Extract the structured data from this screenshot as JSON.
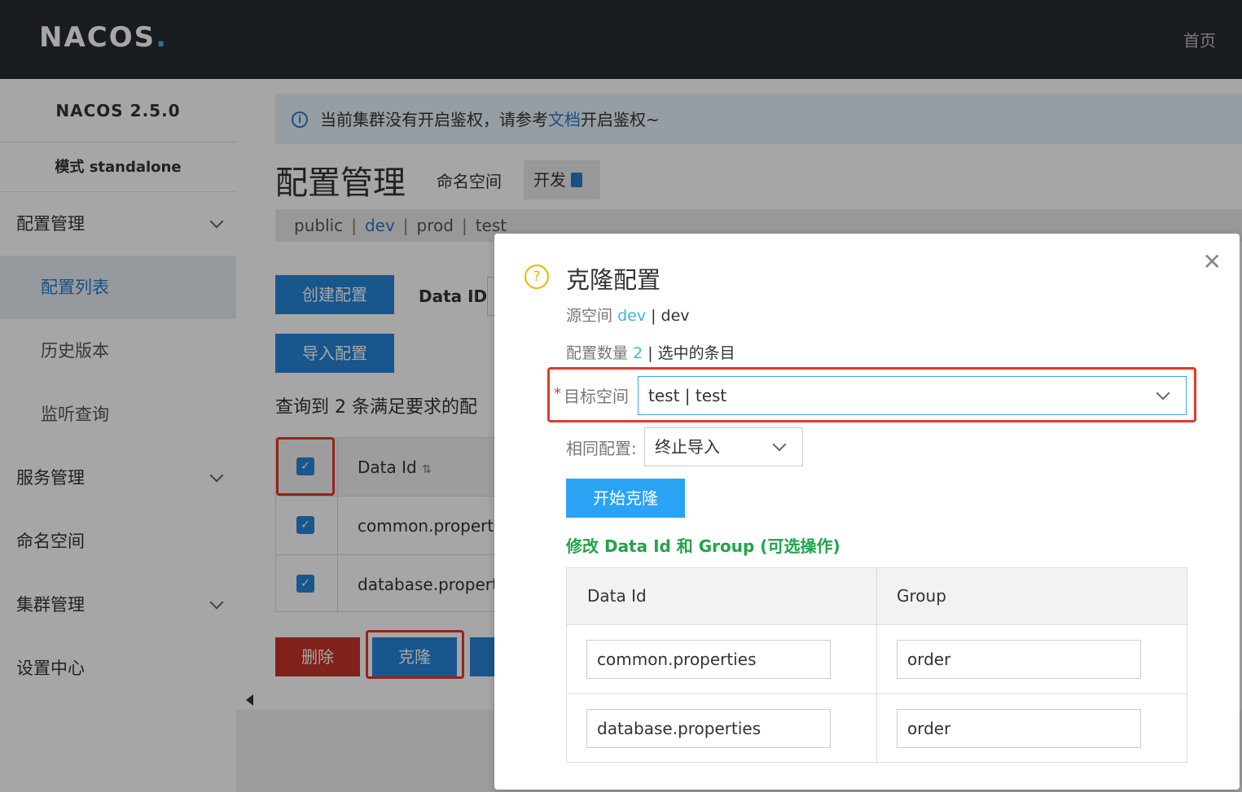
{
  "topbar": {
    "logo_main": "NACOS",
    "logo_dot": ".",
    "home": "首页"
  },
  "sidebar": {
    "version": "NACOS 2.5.0",
    "mode": "模式 standalone",
    "items": [
      {
        "label": "配置管理"
      },
      {
        "label": "配置列表"
      },
      {
        "label": "历史版本"
      },
      {
        "label": "监听查询"
      },
      {
        "label": "服务管理"
      },
      {
        "label": "命名空间"
      },
      {
        "label": "集群管理"
      },
      {
        "label": "设置中心"
      }
    ]
  },
  "main": {
    "notice_prefix": "当前集群没有开启鉴权，请参考",
    "notice_link": "文档",
    "notice_suffix": "开启鉴权~",
    "page_title": "配置管理",
    "namespace_label": "命名空间",
    "namespace_current": "开发",
    "namespaces": [
      "public",
      "dev",
      "prod",
      "test"
    ],
    "create_btn": "创建配置",
    "import_btn": "导入配置",
    "dataid_label": "Data ID",
    "result_text": "查询到 2 条满足要求的配",
    "table": {
      "header_dataid": "Data Id",
      "rows": [
        "common.propertie",
        "database.propertie"
      ]
    },
    "delete_btn": "删除",
    "clone_btn": "克隆"
  },
  "dialog": {
    "title": "克隆配置",
    "source_label": "源空间",
    "source_ns": "dev",
    "source_sep": " | dev",
    "count_label": "配置数量",
    "count_value": "2",
    "count_suffix": " | 选中的条目",
    "target_label": "目标空间",
    "target_value": "test | test",
    "same_label": "相同配置:",
    "same_value": "终止导入",
    "start_btn": "开始克隆",
    "modify_title": "修改 Data Id 和 Group (可选操作)",
    "table": {
      "col_dataid": "Data Id",
      "col_group": "Group",
      "rows": [
        {
          "dataid": "common.properties",
          "group": "order"
        },
        {
          "dataid": "database.properties",
          "group": "order"
        }
      ]
    }
  }
}
